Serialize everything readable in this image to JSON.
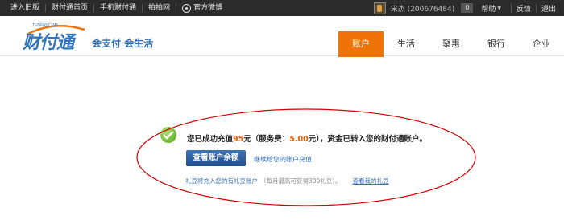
{
  "topbar": {
    "links": [
      "进入旧版",
      "财付通首页",
      "手机财付通",
      "拍拍网",
      "官方微博"
    ],
    "user": "宋杰 (200676484)",
    "badge": "0",
    "help": "帮助",
    "feedback": "反馈",
    "logout": "退出"
  },
  "header": {
    "logo_small": "TENPAY.COM",
    "logo_text": "财付通",
    "slogan": "会支付 会生活",
    "nav": [
      "账户",
      "生活",
      "聚惠",
      "银行",
      "企业"
    ]
  },
  "result": {
    "msg_prefix": "您已成功充值",
    "amount": "95",
    "msg_mid1": "元（服务费：",
    "fee": "5.00",
    "msg_mid2": "元），资金已转入您的财付通账户。",
    "view_button": "查看账户余额",
    "recharge_link": "继续给您的账户充值",
    "note_text": "礼豆将充入您的有礼豆账户",
    "note_gray": "（每月最高可获得300礼豆）。",
    "note_link": "查看我的礼豆"
  },
  "colors": {
    "accent": "#f0730a",
    "brand": "#2f75be",
    "annotation": "#d40000"
  }
}
